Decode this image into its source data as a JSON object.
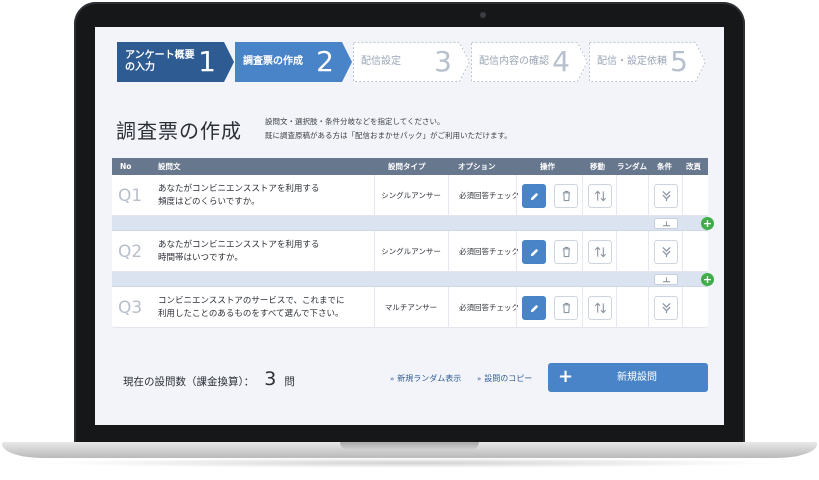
{
  "steps": [
    {
      "label_line1": "アンケート概要",
      "label_line2": "の入力",
      "number": "1",
      "state": "done"
    },
    {
      "label_line1": "調査票の作成",
      "label_line2": "",
      "number": "2",
      "state": "active"
    },
    {
      "label_line1": "配信設定",
      "label_line2": "",
      "number": "3",
      "state": "todo"
    },
    {
      "label_line1": "配信内容の確認",
      "label_line2": "",
      "number": "4",
      "state": "todo"
    },
    {
      "label_line1": "配信・設定依頼",
      "label_line2": "",
      "number": "5",
      "state": "todo"
    }
  ],
  "page": {
    "title": "調査票の作成",
    "desc_line1": "設問文・選択肢・条件分岐などを指定してください。",
    "desc_line2": "既に調査原稿がある方は「配信おまかせパック」がご利用いただけます。"
  },
  "table": {
    "headers": {
      "no": "No",
      "text": "設問文",
      "type": "設問タイプ",
      "option": "オプション",
      "ops": "操作",
      "move": "移動",
      "random": "ランダム",
      "cond": "条件",
      "page": "改頁"
    },
    "rows": [
      {
        "no": "Q1",
        "line1": "あなたがコンビニエンスストアを利用する",
        "line2": "頻度はどのくらいですか。",
        "type": "シングルアンサー",
        "option": "必須回答チェック"
      },
      {
        "no": "Q2",
        "line1": "あなたがコンビニエンスストアを利用する",
        "line2": "時間帯はいつですか。",
        "type": "シングルアンサー",
        "option": "必須回答チェック"
      },
      {
        "no": "Q3",
        "line1": "コンビニエンスストアのサービスで、これまでに",
        "line2": "利用したことのあるものをすべて選んで下さい。",
        "type": "マルチアンサー",
        "option": "必須回答チェック"
      }
    ],
    "add_symbol": "+"
  },
  "footer": {
    "count_label": "現在の設問数（課金換算）：",
    "count_value": "3",
    "count_unit": "問",
    "link_random": "新規ランダム表示",
    "link_copy": "設問のコピー",
    "link_arrow": "»",
    "new_button_icon": "+",
    "new_button": "新規設問"
  },
  "icons": [
    "pencil-icon",
    "trash-icon",
    "sort-arrows-icon",
    "branch-icon",
    "page-break-icon",
    "plus-icon"
  ],
  "colors": {
    "step_done": "#2f5b93",
    "step_active": "#4a84c8",
    "header": "#67778d",
    "accent": "#4a84c8",
    "add": "#3fae49"
  }
}
